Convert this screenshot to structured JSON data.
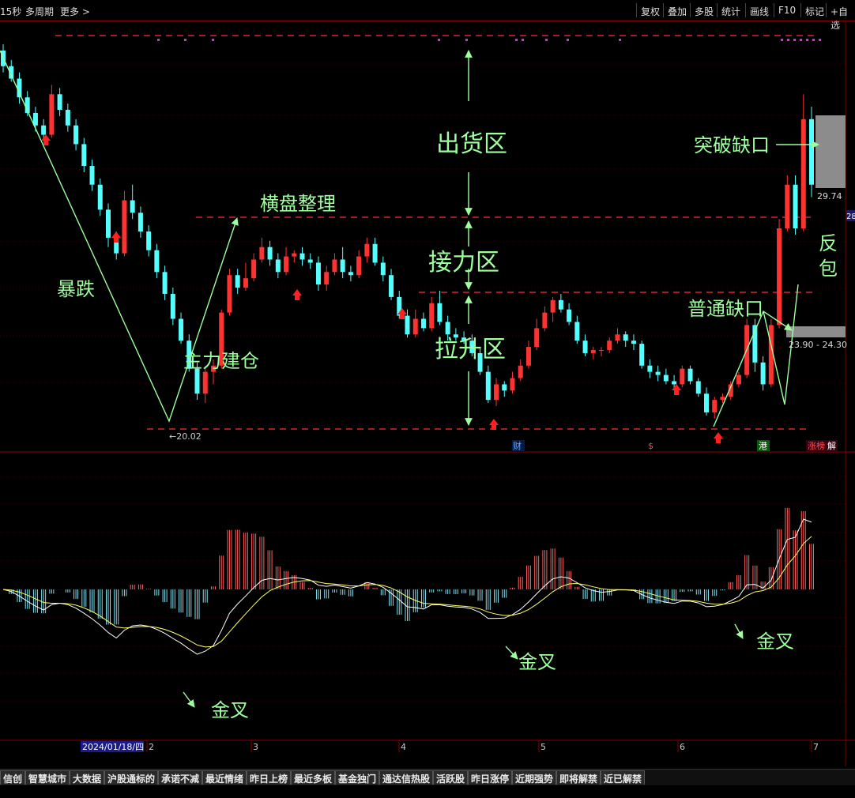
{
  "toolbar": {
    "left": [
      "15秒",
      "多周期",
      "更多 >"
    ],
    "buttons": [
      "复权",
      "叠加",
      "多股",
      "统计",
      "画线",
      "F10",
      "标记",
      "+自选"
    ]
  },
  "annotations": {
    "crash": "暴跌",
    "build_position": "主力建仓",
    "consolidation": "横盘整理",
    "distribution_zone": "出货区",
    "relay_zone": "接力区",
    "lift_zone": "拉升区",
    "common_gap": "普通缺口",
    "breakout_gap": "突破缺口",
    "engulf": "反包",
    "golden_cross_1": "金叉",
    "golden_cross_2": "金叉",
    "golden_cross_3": "金叉"
  },
  "price_labels": {
    "low": "20.02",
    "right_tag_1": "29.74",
    "right_tag_2": "23.90 - 24.30",
    "right_axis_tag": "28"
  },
  "event_markers": [
    "财",
    "$",
    "港",
    "涨榜",
    "解"
  ],
  "xaxis": {
    "date_label": "2024/01/18/四",
    "ticks": [
      "2",
      "3",
      "4",
      "5",
      "6",
      "7"
    ]
  },
  "tabs": [
    "信创",
    "智慧城市",
    "大数据",
    "沪股通标的",
    "承诺不减",
    "最近情绪",
    "昨日上榜",
    "最近多板",
    "基金独门",
    "通达信热股",
    "活跃股",
    "昨日涨停",
    "近期强势",
    "即将解禁",
    "近已解禁"
  ],
  "colors": {
    "up": "#ff3232",
    "down": "#54ffff",
    "annotation": "#9dff9d",
    "dashed": "#ff3030",
    "macd_line": "#ffffff",
    "signal_line": "#ffff66",
    "gap_box": "#8c8c8c"
  },
  "chart_data": {
    "type": "candlestick",
    "note": "price candles (open, high, low, close), values estimated from chart",
    "candles": [
      [
        31.9,
        32.1,
        31.2,
        31.4
      ],
      [
        31.4,
        31.6,
        30.9,
        31.0
      ],
      [
        31.0,
        31.2,
        30.2,
        30.4
      ],
      [
        30.4,
        30.6,
        29.8,
        29.9
      ],
      [
        29.9,
        30.1,
        29.3,
        29.5
      ],
      [
        29.5,
        29.7,
        29.0,
        29.2
      ],
      [
        29.2,
        30.8,
        29.1,
        30.5
      ],
      [
        30.5,
        30.7,
        29.8,
        30.0
      ],
      [
        30.0,
        30.2,
        29.3,
        29.5
      ],
      [
        29.5,
        29.7,
        28.7,
        28.9
      ],
      [
        28.9,
        29.1,
        28.0,
        28.2
      ],
      [
        28.2,
        28.4,
        27.4,
        27.6
      ],
      [
        27.6,
        27.8,
        26.6,
        26.8
      ],
      [
        26.8,
        27.0,
        25.6,
        25.9
      ],
      [
        25.9,
        26.1,
        25.2,
        25.4
      ],
      [
        25.4,
        27.4,
        25.3,
        27.1
      ],
      [
        27.1,
        27.6,
        26.5,
        26.7
      ],
      [
        26.7,
        26.9,
        25.9,
        26.1
      ],
      [
        26.1,
        26.3,
        25.3,
        25.5
      ],
      [
        25.5,
        25.7,
        24.6,
        24.8
      ],
      [
        24.8,
        25.0,
        23.9,
        24.1
      ],
      [
        24.1,
        24.3,
        23.1,
        23.3
      ],
      [
        23.3,
        23.5,
        22.5,
        22.6
      ],
      [
        22.6,
        22.8,
        21.6,
        21.7
      ],
      [
        21.7,
        21.9,
        20.7,
        20.9
      ],
      [
        20.9,
        21.8,
        20.6,
        21.6
      ],
      [
        21.6,
        22.0,
        21.2,
        21.8
      ],
      [
        21.8,
        23.6,
        21.7,
        23.5
      ],
      [
        23.5,
        24.9,
        23.4,
        24.7
      ],
      [
        24.7,
        24.9,
        24.1,
        24.3
      ],
      [
        24.3,
        25.1,
        24.2,
        24.6
      ],
      [
        24.6,
        25.4,
        24.5,
        25.2
      ],
      [
        25.2,
        25.9,
        25.1,
        25.6
      ],
      [
        25.6,
        25.8,
        25.0,
        25.2
      ],
      [
        25.2,
        25.4,
        24.6,
        24.8
      ],
      [
        24.8,
        25.6,
        24.7,
        25.3
      ],
      [
        25.3,
        25.5,
        25.1,
        25.4
      ],
      [
        25.4,
        25.6,
        25.0,
        25.2
      ],
      [
        25.2,
        25.4,
        24.9,
        25.1
      ],
      [
        25.1,
        25.3,
        24.2,
        24.4
      ],
      [
        24.4,
        25.0,
        24.2,
        24.8
      ],
      [
        24.8,
        25.4,
        24.7,
        25.2
      ],
      [
        25.2,
        25.6,
        24.6,
        24.8
      ],
      [
        24.8,
        25.0,
        24.5,
        24.7
      ],
      [
        24.7,
        25.5,
        24.6,
        25.3
      ],
      [
        25.3,
        25.9,
        25.1,
        25.7
      ],
      [
        25.7,
        25.9,
        25.0,
        25.1
      ],
      [
        25.1,
        25.3,
        24.5,
        24.7
      ],
      [
        24.7,
        24.9,
        23.9,
        24.0
      ],
      [
        24.0,
        24.2,
        23.3,
        23.4
      ],
      [
        23.4,
        23.6,
        22.7,
        22.8
      ],
      [
        22.8,
        23.6,
        22.7,
        23.3
      ],
      [
        23.3,
        23.5,
        22.9,
        23.0
      ],
      [
        23.0,
        24.0,
        22.9,
        23.8
      ],
      [
        23.8,
        24.2,
        23.1,
        23.2
      ],
      [
        23.2,
        23.4,
        22.6,
        22.8
      ],
      [
        22.8,
        23.0,
        22.6,
        22.7
      ],
      [
        22.7,
        22.9,
        22.5,
        22.6
      ],
      [
        22.6,
        22.8,
        22.1,
        22.2
      ],
      [
        22.2,
        22.4,
        21.5,
        21.6
      ],
      [
        21.6,
        21.8,
        20.6,
        20.7
      ],
      [
        20.7,
        21.4,
        20.5,
        21.2
      ],
      [
        21.2,
        21.3,
        20.8,
        21.0
      ],
      [
        21.0,
        21.6,
        20.9,
        21.4
      ],
      [
        21.4,
        22.0,
        21.3,
        21.8
      ],
      [
        21.8,
        22.6,
        21.7,
        22.4
      ],
      [
        22.4,
        23.3,
        22.3,
        23.0
      ],
      [
        23.0,
        23.7,
        22.9,
        23.5
      ],
      [
        23.5,
        24.0,
        23.2,
        23.9
      ],
      [
        23.9,
        24.1,
        23.5,
        23.6
      ],
      [
        23.6,
        23.8,
        23.1,
        23.2
      ],
      [
        23.2,
        23.4,
        22.5,
        22.6
      ],
      [
        22.6,
        22.8,
        22.1,
        22.2
      ],
      [
        22.2,
        22.4,
        22.0,
        22.3
      ],
      [
        22.3,
        22.4,
        22.1,
        22.3
      ],
      [
        22.3,
        22.7,
        22.2,
        22.6
      ],
      [
        22.6,
        23.0,
        22.5,
        22.8
      ],
      [
        22.8,
        22.9,
        22.4,
        22.6
      ],
      [
        22.6,
        22.8,
        22.3,
        22.5
      ],
      [
        22.5,
        22.6,
        21.7,
        21.8
      ],
      [
        21.8,
        22.0,
        21.4,
        21.6
      ],
      [
        21.6,
        21.8,
        21.3,
        21.5
      ],
      [
        21.5,
        21.7,
        21.2,
        21.3
      ],
      [
        21.3,
        21.5,
        21.0,
        21.2
      ],
      [
        21.2,
        21.8,
        21.1,
        21.7
      ],
      [
        21.7,
        21.8,
        21.2,
        21.3
      ],
      [
        21.3,
        21.4,
        20.8,
        20.9
      ],
      [
        20.9,
        21.1,
        20.2,
        20.3
      ],
      [
        20.3,
        20.8,
        20.1,
        20.7
      ],
      [
        20.7,
        20.9,
        20.6,
        20.8
      ],
      [
        20.8,
        21.3,
        20.7,
        21.2
      ],
      [
        21.2,
        21.6,
        21.1,
        21.5
      ],
      [
        21.5,
        23.3,
        21.4,
        23.1
      ],
      [
        23.1,
        23.3,
        21.6,
        21.9
      ],
      [
        21.9,
        22.1,
        21.0,
        21.2
      ],
      [
        21.2,
        23.3,
        21.1,
        23.1
      ],
      [
        23.1,
        26.5,
        23.0,
        26.2
      ],
      [
        26.2,
        27.9,
        26.1,
        27.6
      ],
      [
        27.6,
        27.9,
        26.0,
        26.2
      ],
      [
        26.2,
        30.5,
        26.1,
        29.7
      ],
      [
        29.7,
        30.1,
        27.2,
        27.6
      ]
    ]
  }
}
